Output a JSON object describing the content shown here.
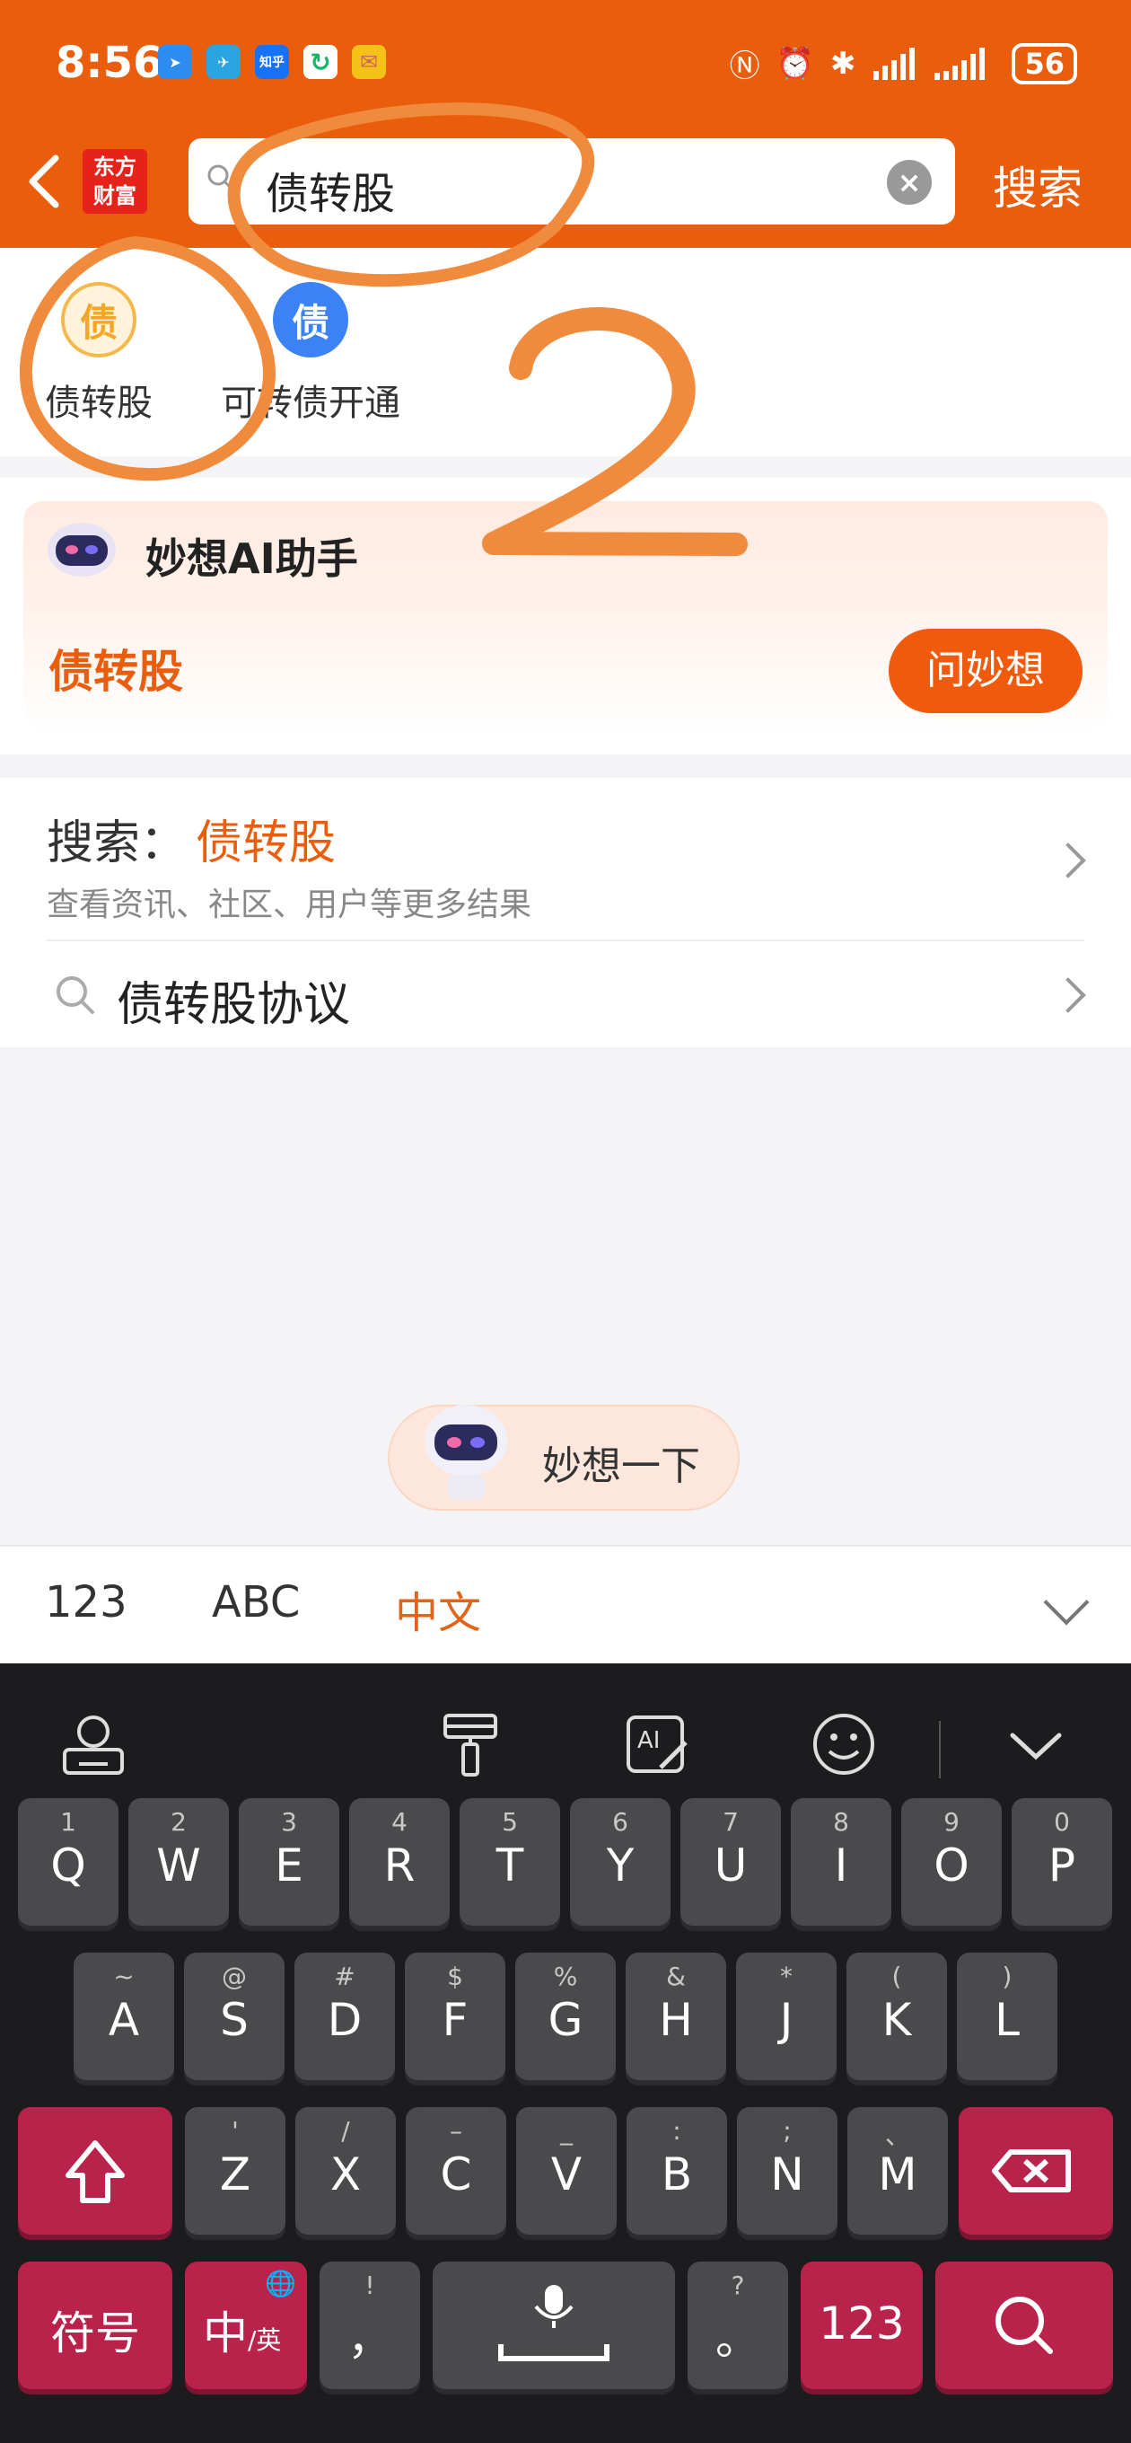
{
  "status_bar": {
    "time": "8:56",
    "app_badges": [
      "bluesky-icon",
      "telegram-icon",
      "zhihu-icon",
      "refresh-app-icon",
      "mail-icon"
    ],
    "zhihu_label": "知乎",
    "battery": "56",
    "indicators": [
      "nfc-icon",
      "alarm-icon",
      "bluetooth-icon",
      "signal-icon",
      "signal-icon"
    ]
  },
  "header": {
    "logo_text": "东方\n财富",
    "search_value": "债转股",
    "search_button": "搜索"
  },
  "quick_entries": [
    {
      "icon_glyph": "债",
      "label": "债转股",
      "icon_color": "#f5a623"
    },
    {
      "icon_glyph": "债",
      "label": "可转债开通",
      "icon_color": "#3b82f6"
    }
  ],
  "ai_card": {
    "name": "妙想AI助手",
    "query": "债转股",
    "button": "问妙想"
  },
  "results": {
    "search_prefix": "搜索：",
    "search_keyword": "债转股",
    "search_hint": "查看资讯、社区、用户等更多结果",
    "suggestion": "债转股协议"
  },
  "ai_pill": {
    "label": "妙想一下"
  },
  "input_modes": {
    "tabs": [
      "123",
      "ABC",
      "中文"
    ],
    "active": "中文",
    "active_color": "#e0641a"
  },
  "keyboard": {
    "row1": [
      [
        "1",
        "Q"
      ],
      [
        "2",
        "W"
      ],
      [
        "3",
        "E"
      ],
      [
        "4",
        "R"
      ],
      [
        "5",
        "T"
      ],
      [
        "6",
        "Y"
      ],
      [
        "7",
        "U"
      ],
      [
        "8",
        "I"
      ],
      [
        "9",
        "O"
      ],
      [
        "0",
        "P"
      ]
    ],
    "row2": [
      [
        "~",
        "A"
      ],
      [
        "@",
        "S"
      ],
      [
        "#",
        "D"
      ],
      [
        "$",
        "F"
      ],
      [
        "%",
        "G"
      ],
      [
        "&",
        "H"
      ],
      [
        "*",
        "J"
      ],
      [
        "(",
        "K"
      ],
      [
        ")",
        "L"
      ]
    ],
    "row3": [
      [
        "'",
        "Z"
      ],
      [
        "/",
        "X"
      ],
      [
        "–",
        "C"
      ],
      [
        "_",
        "V"
      ],
      [
        ":",
        "B"
      ],
      [
        ";",
        "N"
      ],
      [
        "、",
        "M"
      ]
    ],
    "symbols_key": "符号",
    "lang_key_main": "中",
    "lang_key_sub": "/英",
    "comma_key_sub": "!",
    "comma_key": "，",
    "period_key_sub": "?",
    "period_key": "。",
    "numbers_key": "123",
    "accent_color": "#b9224a"
  },
  "annotations": {
    "number": "2",
    "color": "#f08a3c"
  }
}
